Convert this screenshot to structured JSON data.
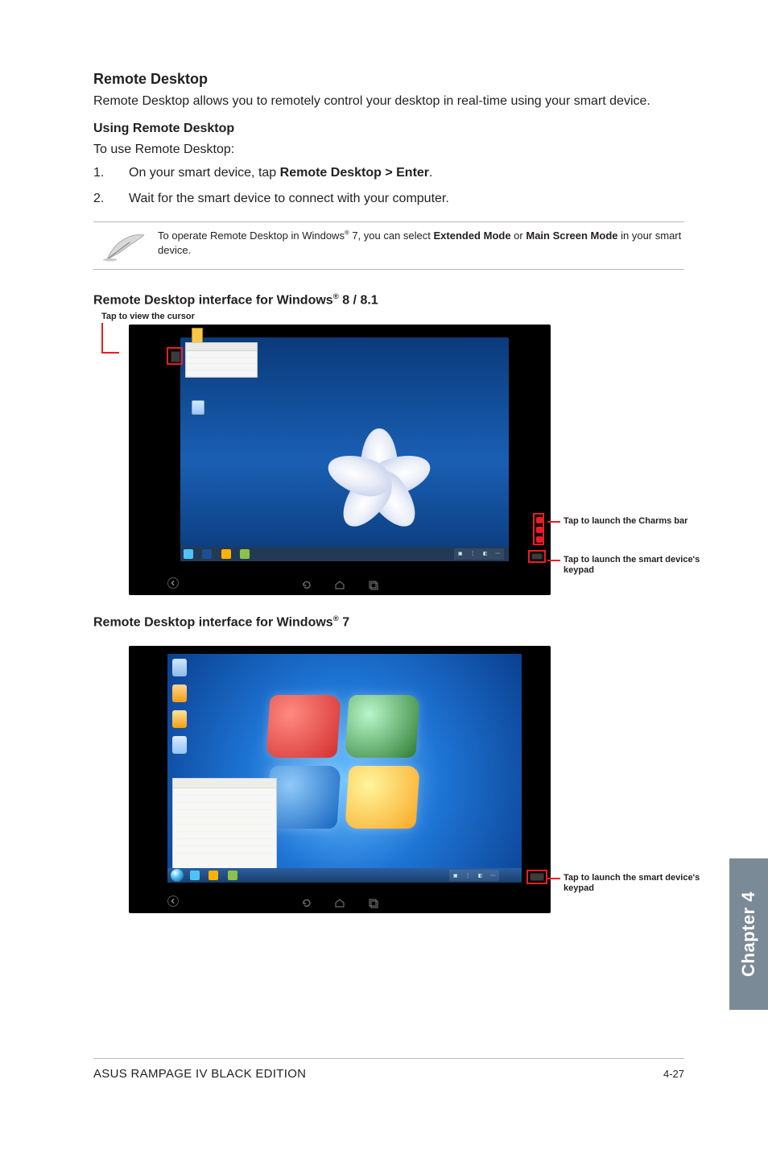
{
  "section": {
    "title": "Remote Desktop",
    "intro": "Remote Desktop allows you to remotely control your desktop in real-time using your smart device.",
    "subheading": "Using Remote Desktop",
    "lead": "To use Remote Desktop:",
    "steps": [
      {
        "num": "1.",
        "pre": "On your smart device, tap ",
        "bold": "Remote Desktop > Enter",
        "post": "."
      },
      {
        "num": "2.",
        "pre": "Wait for the smart device to connect with your computer.",
        "bold": "",
        "post": ""
      }
    ],
    "note": {
      "pre": "To operate Remote Desktop in Windows",
      "mid": " 7, you can select ",
      "b1": "Extended Mode",
      "or": " or ",
      "b2": "Main Screen Mode",
      "post": " in your smart device."
    },
    "heading_win8_pre": "Remote Desktop interface for Windows",
    "heading_win8_post": " 8 / 8.1",
    "heading_win7_pre": "Remote Desktop interface for Windows",
    "heading_win7_post": " 7"
  },
  "callouts": {
    "cursor": "Tap to view the cursor",
    "charms": "Tap to launch the Charms bar",
    "keypad": "Tap to launch the smart device's keypad"
  },
  "chapter_tab": "Chapter 4",
  "footer": {
    "left": "ASUS RAMPAGE IV BLACK EDITION",
    "right": "4-27"
  }
}
